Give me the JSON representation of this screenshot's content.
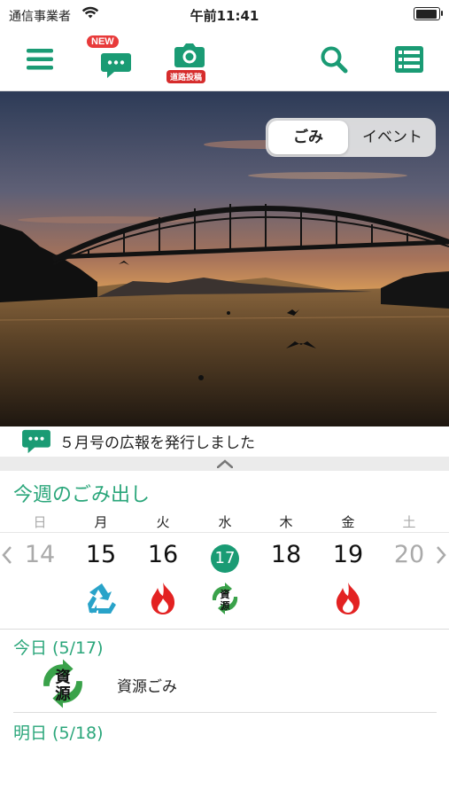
{
  "status": {
    "carrier": "通信事業者",
    "time": "午前11:41"
  },
  "toolbar": {
    "new_badge": "NEW",
    "road_badge": "道路投稿"
  },
  "hero": {
    "segments": [
      "ごみ",
      "イベント"
    ],
    "selected": "ごみ"
  },
  "news": {
    "text": "５月号の広報を発行しました"
  },
  "week": {
    "title": "今週のごみ出し",
    "days": [
      "日",
      "月",
      "火",
      "水",
      "木",
      "金",
      "土"
    ],
    "dates": [
      "14",
      "15",
      "16",
      "17",
      "18",
      "19",
      "20"
    ],
    "today_index": 3,
    "day_icons": [
      "",
      "recycle-icon",
      "burnable-icon",
      "resource-icon",
      "",
      "burnable-icon",
      ""
    ],
    "resource_icon_text": [
      "資",
      "源"
    ]
  },
  "today": {
    "label": "今日 (5/17)",
    "items": [
      {
        "icon": "resource-icon",
        "name": "資源ごみ"
      }
    ]
  },
  "tomorrow": {
    "label": "明日 (5/18)"
  },
  "colors": {
    "accent": "#1a9b74",
    "label_green": "#2aa67a",
    "fire": "#e32222",
    "recycle": "#29a3c9"
  }
}
